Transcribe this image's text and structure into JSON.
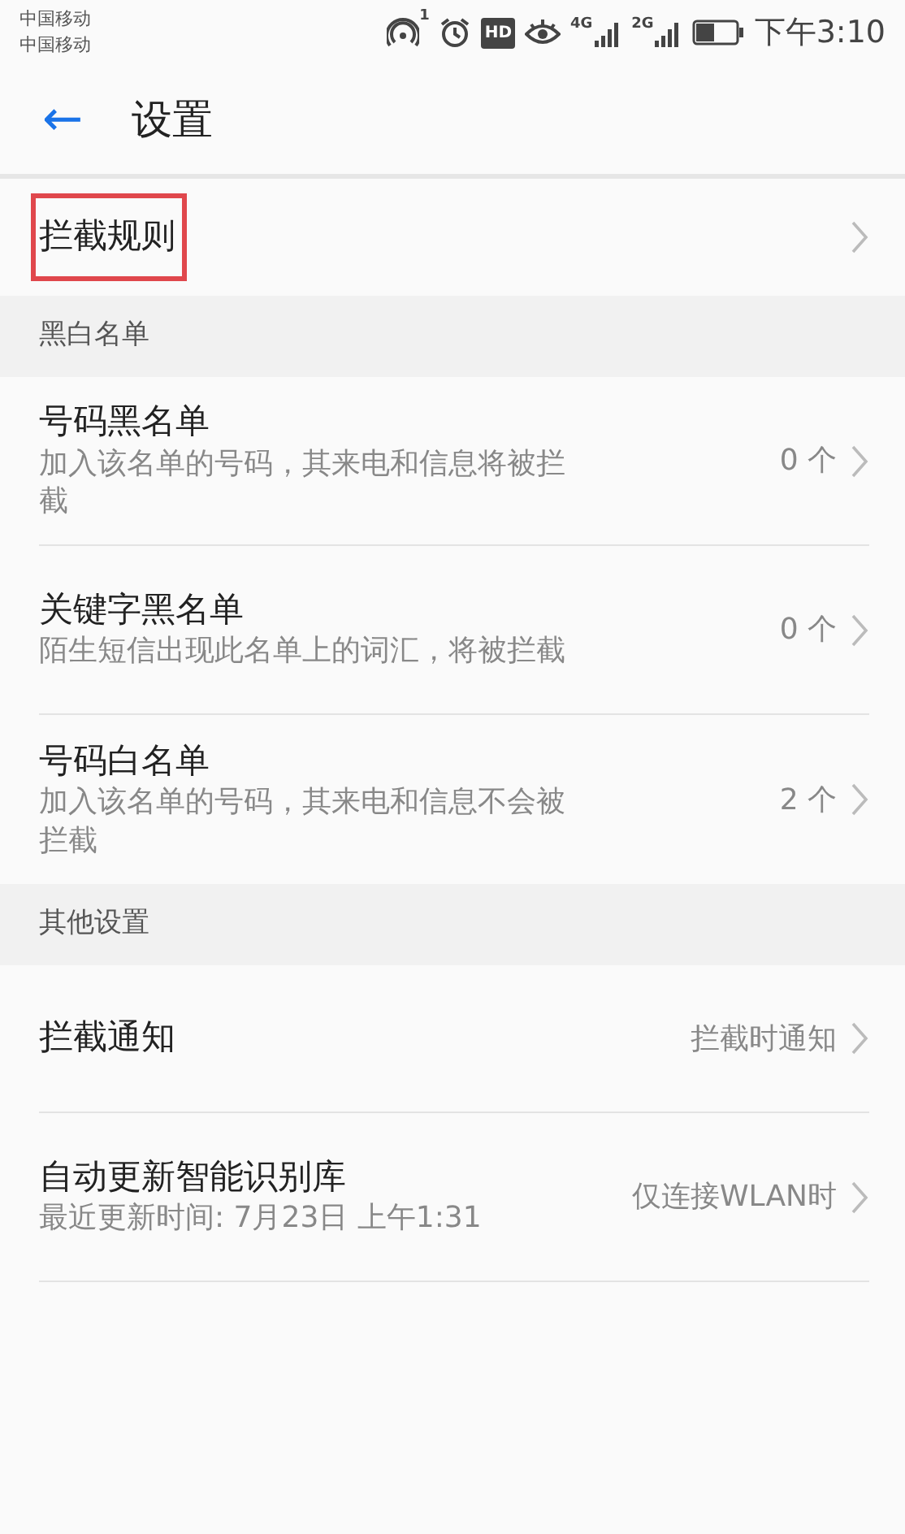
{
  "status_bar": {
    "carriers": [
      "中国移动",
      "中国移动"
    ],
    "hotspot_count": "1",
    "hd": "HD",
    "network_1": "4G",
    "network_2": "2G",
    "time": "下午3:10"
  },
  "header": {
    "back": "←",
    "title": "设置"
  },
  "top_rows": [
    {
      "title": "拦截规则",
      "highlighted": true
    }
  ],
  "sections": [
    {
      "title": "黑白名单",
      "rows": [
        {
          "title": "号码黑名单",
          "subtitle": "加入该名单的号码，其来电和信息将被拦截",
          "value": "0 个"
        },
        {
          "title": "关键字黑名单",
          "subtitle": "陌生短信出现此名单上的词汇，将被拦截",
          "value": "0 个"
        },
        {
          "title": "号码白名单",
          "subtitle": "加入该名单的号码，其来电和信息不会被拦截",
          "value": "2 个"
        }
      ]
    },
    {
      "title": "其他设置",
      "rows": [
        {
          "title": "拦截通知",
          "value": "拦截时通知"
        },
        {
          "title": "自动更新智能识别库",
          "subtitle": "最近更新时间: 7月23日 上午1:31",
          "value": "仅连接WLAN时"
        }
      ]
    }
  ]
}
